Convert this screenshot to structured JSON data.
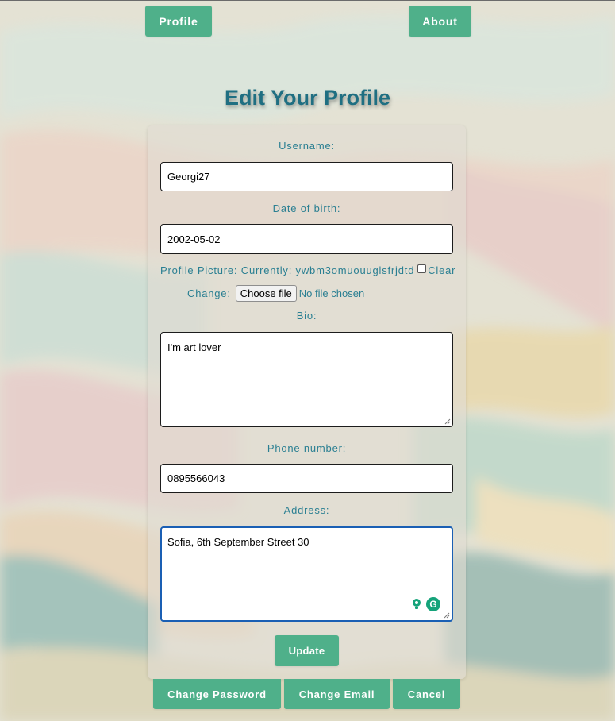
{
  "nav": {
    "profile_label": "Profile",
    "about_label": "About"
  },
  "page": {
    "title": "Edit Your Profile"
  },
  "form": {
    "username_label": "Username:",
    "username_value": "Georgi27",
    "dob_label": "Date of birth:",
    "dob_value": "2002-05-02",
    "picture_label": "Profile Picture:",
    "picture_currently": "Currently:",
    "picture_filename": "ywbm3omuouuglsfrjdtd",
    "picture_clear": "Clear",
    "picture_change": "Change:",
    "choose_file_label": "Choose file",
    "no_file_text": "No file chosen",
    "bio_label": "Bio:",
    "bio_value": "I'm art lover",
    "phone_label": "Phone number:",
    "phone_value": "0895566043",
    "address_label": "Address:",
    "address_value": "Sofia, 6th September Street 30",
    "update_label": "Update"
  },
  "footer": {
    "change_password_label": "Change Password",
    "change_email_label": "Change Email",
    "cancel_label": "Cancel"
  },
  "colors": {
    "accent": "#4fb08a",
    "title": "#1f6f82",
    "label": "#2a7f92",
    "focus": "#1a5fb4"
  },
  "icons": {
    "grammarly_suggest": "lightbulb-icon",
    "grammarly_logo": "grammarly-icon"
  }
}
